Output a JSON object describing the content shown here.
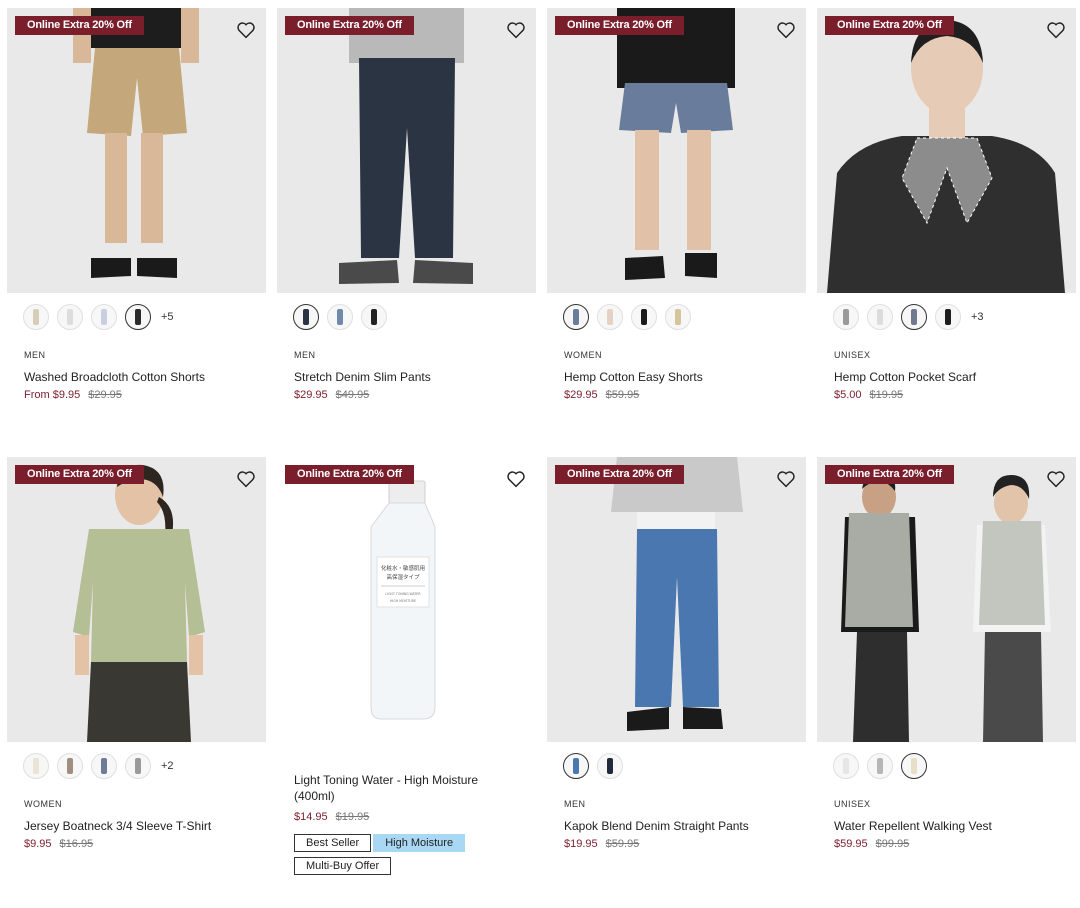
{
  "promo_label": "Online Extra 20% Off",
  "colors": {
    "promo_bg": "#7b1e2c",
    "price_red": "#7b1e2c",
    "tag_blue": "#a9d8f5"
  },
  "products": [
    {
      "category": "MEN",
      "name": "Washed Broadcloth Cotton Shorts",
      "price": "From $9.95",
      "was": "$29.95",
      "more": "+5",
      "promo": true
    },
    {
      "category": "MEN",
      "name": "Stretch Denim Slim Pants",
      "price": "$29.95",
      "was": "$49.95",
      "more": "",
      "promo": true
    },
    {
      "category": "WOMEN",
      "name": "Hemp Cotton Easy Shorts",
      "price": "$29.95",
      "was": "$59.95",
      "more": "",
      "promo": true
    },
    {
      "category": "UNISEX",
      "name": "Hemp Cotton Pocket Scarf",
      "price": "$5.00",
      "was": "$19.95",
      "more": "+3",
      "promo": true
    },
    {
      "category": "WOMEN",
      "name": "Jersey Boatneck 3/4 Sleeve T-Shirt",
      "price": "$9.95",
      "was": "$16.95",
      "more": "+2",
      "promo": true
    },
    {
      "category": "",
      "name": "Light Toning Water - High Moisture (400ml)",
      "price": "$14.95",
      "was": "$19.95",
      "more": "",
      "promo": true,
      "tags": [
        "Best Seller",
        "High Moisture",
        "Multi-Buy Offer"
      ],
      "bottle_label_jp_1": "化粧水・敏感肌用",
      "bottle_label_jp_2": "高保湿タイプ",
      "bottle_label_en_1": "LIGHT TONING WATER",
      "bottle_label_en_2": "HIGH MOISTURE"
    },
    {
      "category": "MEN",
      "name": "Kapok Blend Denim Straight Pants",
      "price": "$19.95",
      "was": "$59.95",
      "more": "",
      "promo": true
    },
    {
      "category": "UNISEX",
      "name": "Water Repellent Walking Vest",
      "price": "$59.95",
      "was": "$99.95",
      "more": "",
      "promo": true
    }
  ]
}
